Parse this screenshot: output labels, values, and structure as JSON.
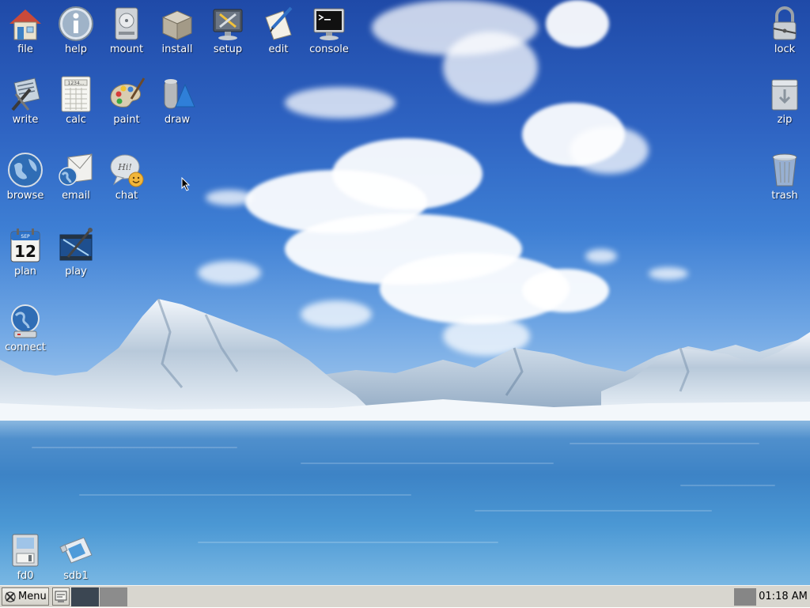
{
  "desktop_icons": {
    "file": "file",
    "help": "help",
    "mount": "mount",
    "install": "install",
    "setup": "setup",
    "edit": "edit",
    "console": "console",
    "write": "write",
    "calc": "calc",
    "paint": "paint",
    "draw": "draw",
    "browse": "browse",
    "email": "email",
    "chat": "chat",
    "plan": "plan",
    "play": "play",
    "connect": "connect",
    "fd0": "fd0",
    "sdb1": "sdb1",
    "lock": "lock",
    "zip": "zip",
    "trash": "trash"
  },
  "icon_texts": {
    "calc_digits": "1234...",
    "plan_day": "12",
    "plan_month": "SEP",
    "chat_bubble": "Hi!"
  },
  "taskbar": {
    "menu_label": "Menu",
    "clock": "01:18 AM"
  },
  "colors": {
    "sky_top": "#1f4aa8",
    "water": "#3d83c6",
    "taskbar": "#d8d6cf",
    "workspace_active": "#3b4652",
    "workspace_inactive": "#8c8c8c"
  }
}
